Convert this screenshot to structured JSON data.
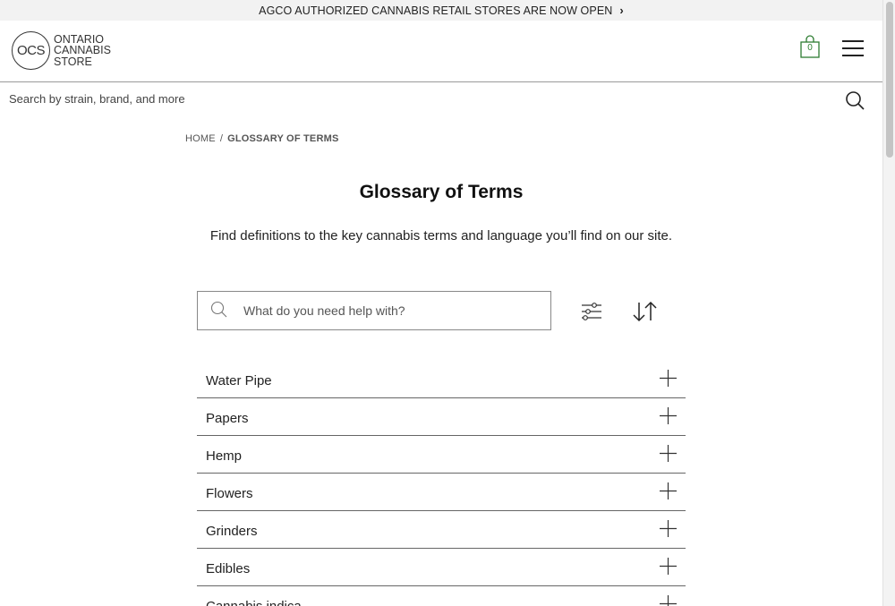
{
  "promo": {
    "text": "AGCO AUTHORIZED CANNABIS RETAIL STORES ARE NOW OPEN",
    "chevron": "›"
  },
  "logo": {
    "mark": "OCS",
    "lines": [
      "ONTARIO",
      "CANNABIS",
      "STORE"
    ]
  },
  "cart": {
    "count": "0",
    "icon": "shopping-bag-icon",
    "color": "#2e7d32"
  },
  "search": {
    "placeholder": "Search by strain, brand, and more"
  },
  "breadcrumb": {
    "home": "HOME",
    "separator": "/",
    "current": "GLOSSARY OF TERMS"
  },
  "page": {
    "title": "Glossary of Terms",
    "subtitle": "Find definitions to the key cannabis terms and language you’ll find on our site."
  },
  "help_search": {
    "placeholder": "What do you need help with?"
  },
  "glossary": {
    "items": [
      {
        "label": "Water Pipe"
      },
      {
        "label": "Papers"
      },
      {
        "label": "Hemp"
      },
      {
        "label": "Flowers"
      },
      {
        "label": "Grinders"
      },
      {
        "label": "Edibles"
      },
      {
        "label": "Cannabis indica"
      }
    ]
  }
}
